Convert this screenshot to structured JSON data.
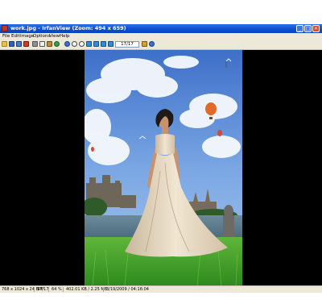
{
  "window": {
    "title": "work.jpg - IrfanView (Zoom: 494 x 659)",
    "title_bar_color": "#0a4fd0",
    "buttons": {
      "minimize": "_",
      "maximize": "□",
      "close": "×"
    }
  },
  "menu": {
    "items": [
      "File",
      "Edit",
      "Image",
      "Options",
      "View",
      "Help"
    ]
  },
  "toolbar": {
    "counter": "17/17",
    "icons": [
      "open-folder-icon",
      "save-icon",
      "save-as-icon",
      "delete-icon",
      "cut-icon",
      "copy-icon",
      "paste-icon",
      "undo-icon",
      "info-icon",
      "zoom-in-icon",
      "zoom-out-icon",
      "first-file-icon",
      "previous-file-icon",
      "next-file-icon",
      "last-file-icon",
      "slideshow-icon",
      "settings-icon",
      "help-icon"
    ]
  },
  "status": {
    "dimensions": "768 x 1024 x 24 BPP",
    "index": "17/17",
    "zoom": "64 %",
    "size": "402.01 KB / 2.25 MB",
    "datetime": "3/19/2009 / 04:16:04"
  },
  "image": {
    "description_colors": {
      "sky": "#5f8fd8",
      "grass": "#3f9d2a",
      "dress": "#e9dcc6"
    }
  }
}
